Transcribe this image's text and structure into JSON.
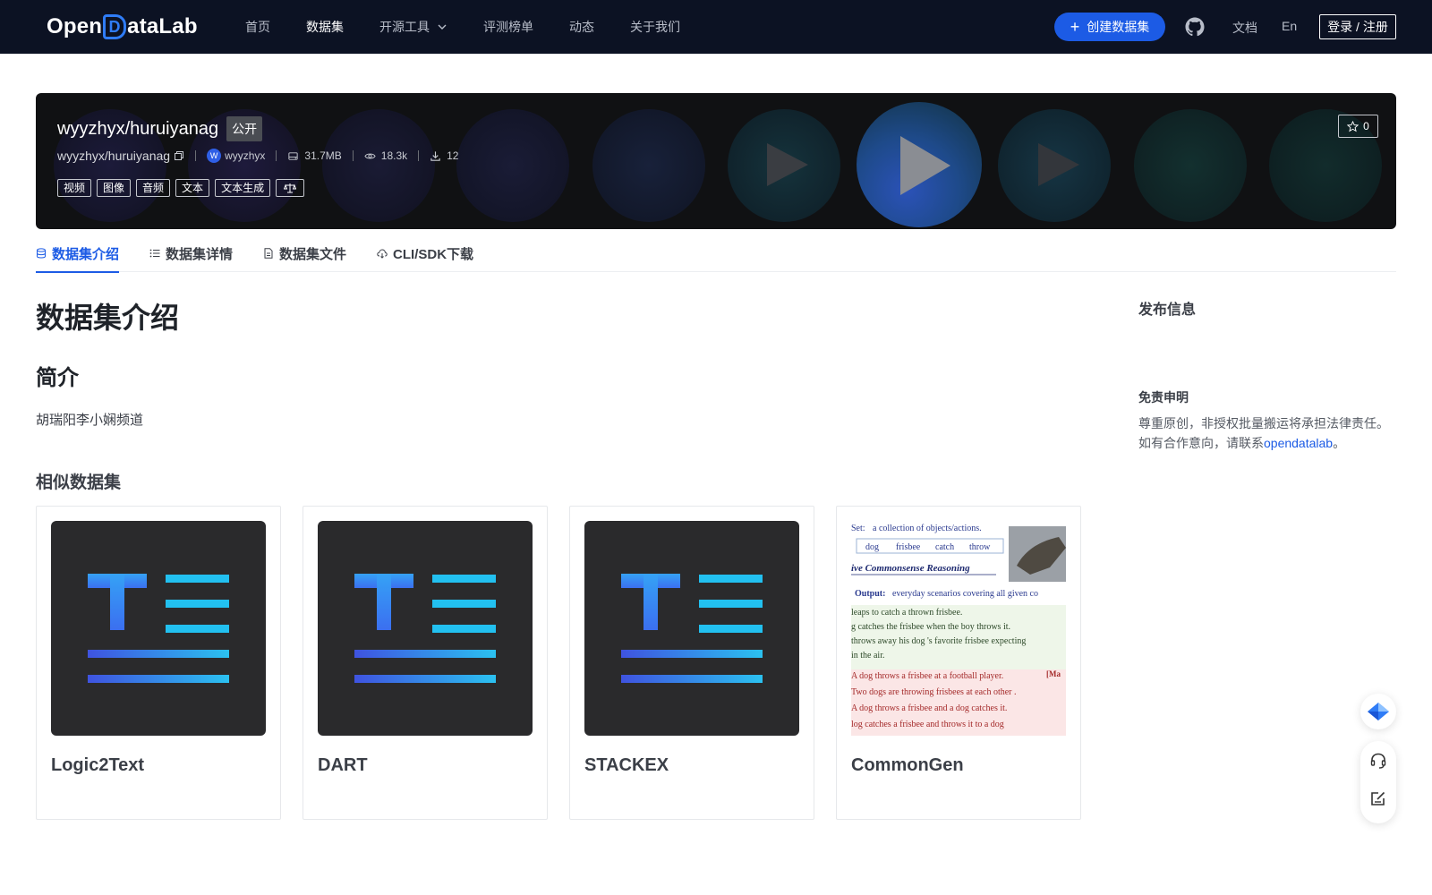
{
  "nav": {
    "logo_text_left": "Open",
    "logo_text_d": "D",
    "logo_text_right": "ataLab",
    "links": [
      {
        "label": "首页"
      },
      {
        "label": "数据集"
      },
      {
        "label": "开源工具"
      },
      {
        "label": "评测榜单"
      },
      {
        "label": "动态"
      },
      {
        "label": "关于我们"
      }
    ],
    "create_label": "创建数据集",
    "doc_label": "文档",
    "lang_label": "En",
    "login_label": "登录 / 注册"
  },
  "dataset": {
    "title": "wyyzhyx/huruiyanag",
    "visibility": "公开",
    "path": "wyyzhyx/huruiyanag",
    "owner_avatar": "W",
    "owner": "wyyzhyx",
    "size": "31.7MB",
    "views": "18.3k",
    "downloads": "12",
    "stars": "0",
    "tags": [
      "视频",
      "图像",
      "音频",
      "文本",
      "文本生成"
    ]
  },
  "tabs": [
    {
      "label": "数据集介绍"
    },
    {
      "label": "数据集详情"
    },
    {
      "label": "数据集文件"
    },
    {
      "label": "CLI/SDK下载"
    }
  ],
  "content": {
    "heading": "数据集介绍",
    "section": "简介",
    "description": "胡瑞阳李小娴频道",
    "similar_heading": "相似数据集",
    "similar": [
      {
        "name": "Logic2Text"
      },
      {
        "name": "DART"
      },
      {
        "name": "STACKEX"
      },
      {
        "name": "CommonGen"
      }
    ]
  },
  "commongen_preview": {
    "line1_label": "Set:",
    "line1_text": "a collection of objects/actions.",
    "chips": [
      "dog",
      "frisbee",
      "catch",
      "throw"
    ],
    "heading": "ive Commonsense Reasoning",
    "output_label": "Output:",
    "output_text": "everyday scenarios covering all given co",
    "good": [
      "leaps to catch a thrown frisbee.",
      "g catches the frisbee when the boy throws it.",
      "throws away his dog 's favorite frisbee expecting",
      "in the air."
    ],
    "bad": [
      "A dog throws a frisbee at a football player.",
      "Two dogs are throwing frisbees at each other .",
      "A dog throws a frisbee and a dog catches it.",
      "log catches a frisbee and throws it to a dog"
    ],
    "bad_marker": "[Ma"
  },
  "sidebar": {
    "release_title": "发布信息",
    "disclaimer_title": "免责申明",
    "disclaimer_line1": "尊重原创，非授权批量搬运将承担法律责任。",
    "disclaimer_line2_prefix": "如有合作意向，请联系",
    "disclaimer_link": "opendatalab",
    "disclaimer_line2_suffix": "。"
  },
  "colors": {
    "nav_bg": "#0c1223",
    "accent": "#1c5be5",
    "banner_bg": "#101113"
  }
}
